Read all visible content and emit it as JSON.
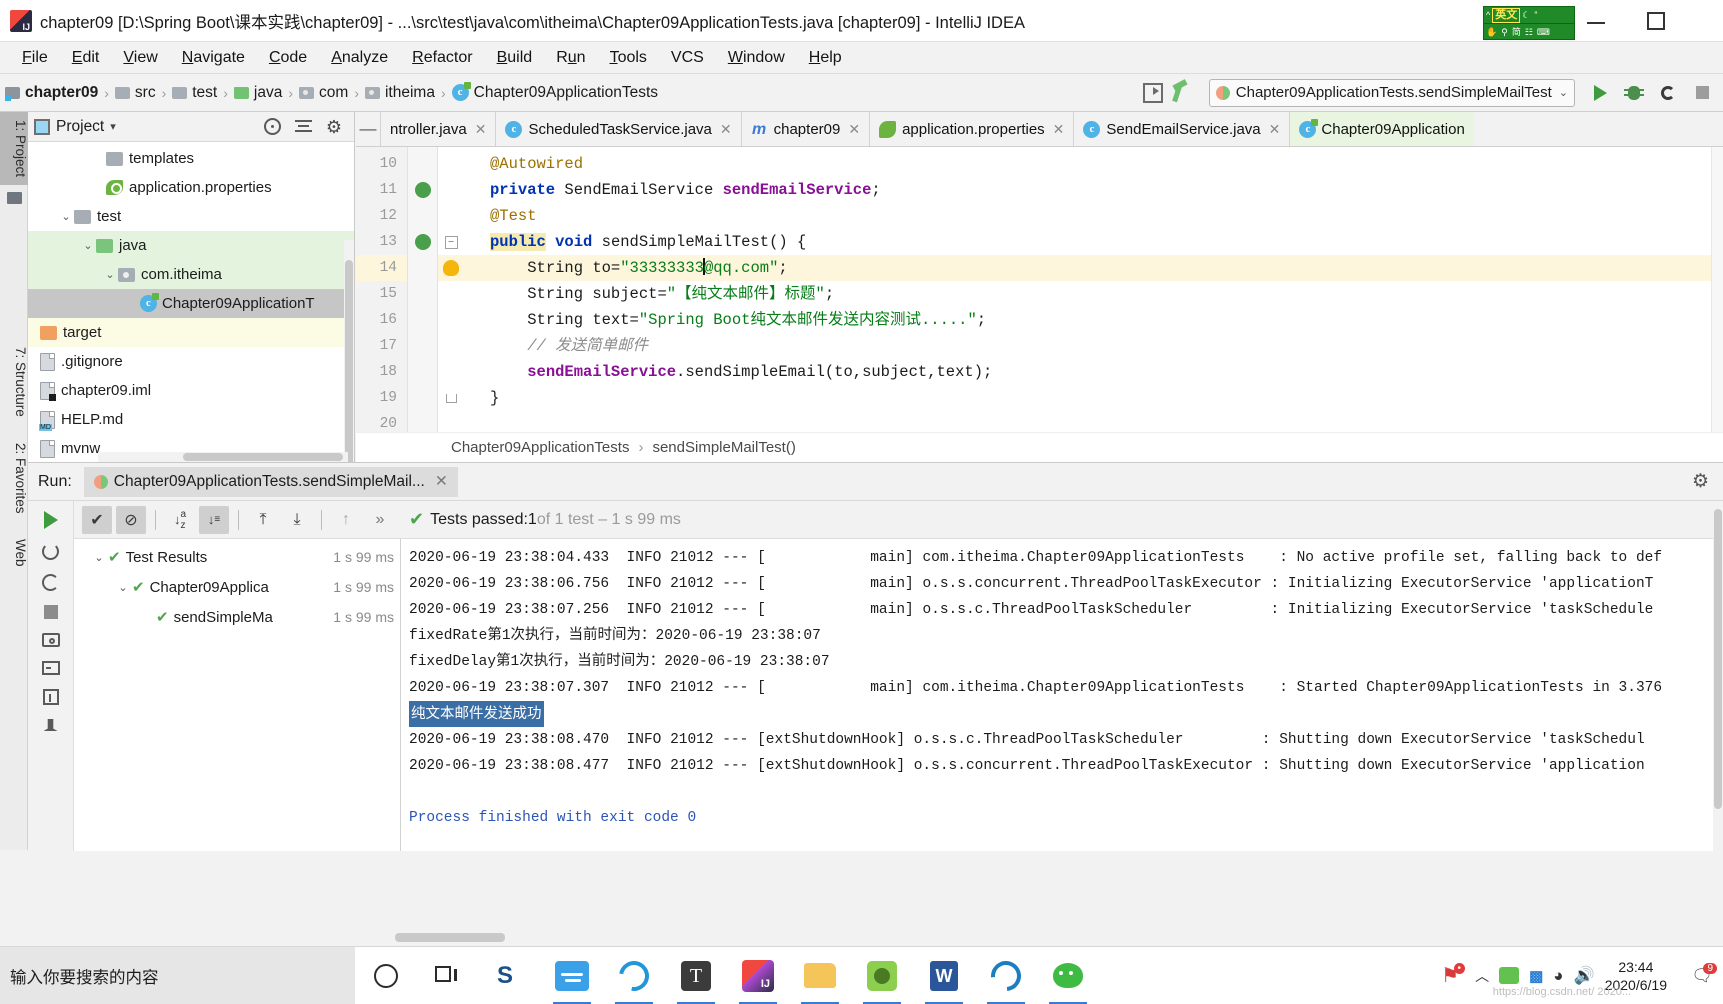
{
  "window": {
    "title": "chapter09 [D:\\Spring Boot\\课本实践\\chapter09] - ...\\src\\test\\java\\com\\itheima\\Chapter09ApplicationTests.java [chapter09] - IntelliJ IDEA",
    "logo_icon": "intellij-idea-logo",
    "minimize_label": "—",
    "maximize_label": "☐"
  },
  "ime": {
    "mode_label": "英文",
    "hand_icon": "hand-icon",
    "search_icon": "search-icon",
    "simplified_label": "简",
    "panel_icon": "soft-keyboard-icon",
    "moon_icon": "moon-icon",
    "quote_icon": "quote-icon",
    "up_icon": "caret-up-icon",
    "color": "#1f8a27"
  },
  "menubar": {
    "items": [
      {
        "label": "File",
        "mnemonic": "F"
      },
      {
        "label": "Edit",
        "mnemonic": "E"
      },
      {
        "label": "View",
        "mnemonic": "V"
      },
      {
        "label": "Navigate",
        "mnemonic": "N"
      },
      {
        "label": "Code",
        "mnemonic": "C"
      },
      {
        "label": "Analyze",
        "mnemonic": "A"
      },
      {
        "label": "Refactor",
        "mnemonic": "R"
      },
      {
        "label": "Build",
        "mnemonic": "B"
      },
      {
        "label": "Run",
        "mnemonic": "u"
      },
      {
        "label": "Tools",
        "mnemonic": "T"
      },
      {
        "label": "VCS",
        "mnemonic": "V"
      },
      {
        "label": "Window",
        "mnemonic": "W"
      },
      {
        "label": "Help",
        "mnemonic": "H"
      }
    ]
  },
  "navbar": {
    "breadcrumbs": [
      {
        "label": "chapter09",
        "icon": "project-folder-icon"
      },
      {
        "label": "src",
        "icon": "folder-icon"
      },
      {
        "label": "test",
        "icon": "folder-icon"
      },
      {
        "label": "java",
        "icon": "source-root-folder-icon"
      },
      {
        "label": "com",
        "icon": "package-icon"
      },
      {
        "label": "itheima",
        "icon": "package-icon"
      },
      {
        "label": "Chapter09ApplicationTests",
        "icon": "test-class-icon"
      }
    ],
    "separator": "›",
    "preview_icon": "preview-icon",
    "build_icon": "hammer-icon",
    "run_config": "Chapter09ApplicationTests.sendSimpleMailTest",
    "run_config_chevron": "⌄",
    "run_icon": "run-icon",
    "debug_icon": "debug-icon",
    "coverage_icon": "run-with-coverage-icon",
    "stop_icon": "stop-icon"
  },
  "stripe": {
    "project_label": "1: Project",
    "structure_label": "7: Structure",
    "favorites_label": "2: Favorites",
    "web_label": "Web"
  },
  "project_panel": {
    "title": "Project",
    "chevron": "▾",
    "locate_icon": "locate-icon",
    "collapse_icon": "collapse-all-icon",
    "settings_icon": "gear-icon",
    "tree": [
      {
        "label": "templates",
        "icon": "folder-icon",
        "indent": 4,
        "arrow": "",
        "state": "none"
      },
      {
        "label": "application.properties",
        "icon": "spring-properties-icon",
        "indent": 4,
        "arrow": "",
        "state": "none"
      },
      {
        "label": "test",
        "icon": "folder-icon",
        "indent": 2,
        "arrow": "⌄",
        "state": "none"
      },
      {
        "label": "java",
        "icon": "source-root-folder-icon",
        "indent": 3,
        "arrow": "⌄",
        "state": "green"
      },
      {
        "label": "com.itheima",
        "icon": "package-icon",
        "indent": 4,
        "arrow": "⌄",
        "state": "green"
      },
      {
        "label": "Chapter09ApplicationT",
        "icon": "test-class-icon",
        "indent": 5,
        "arrow": "",
        "state": "gray"
      },
      {
        "label": "target",
        "icon": "excluded-folder-icon",
        "indent": 1,
        "arrow": "",
        "state": "yellow"
      },
      {
        "label": ".gitignore",
        "icon": "file-icon",
        "indent": 1,
        "arrow": "",
        "state": "none"
      },
      {
        "label": "chapter09.iml",
        "icon": "iml-file-icon",
        "indent": 1,
        "arrow": "",
        "state": "none"
      },
      {
        "label": "HELP.md",
        "icon": "markdown-file-icon",
        "indent": 1,
        "arrow": "",
        "state": "none"
      },
      {
        "label": "mvnw",
        "icon": "file-icon",
        "indent": 1,
        "arrow": "",
        "state": "none"
      }
    ]
  },
  "editor": {
    "tabs": [
      {
        "label": "ntroller.java",
        "icon": "java-class-icon",
        "active": false,
        "truncated": true
      },
      {
        "label": "ScheduledTaskService.java",
        "icon": "java-class-icon",
        "active": false
      },
      {
        "label": "chapter09",
        "icon": "maven-icon",
        "active": false
      },
      {
        "label": "application.properties",
        "icon": "spring-properties-icon",
        "active": false
      },
      {
        "label": "SendEmailService.java",
        "icon": "java-class-icon",
        "active": false
      },
      {
        "label": "Chapter09Application",
        "icon": "test-class-icon",
        "active": true
      }
    ],
    "close_label": "✕",
    "minimize_tab_label": "—",
    "lines": [
      {
        "no": "10",
        "text": "@Autowired"
      },
      {
        "no": "11",
        "text": "private SendEmailService sendEmailService;"
      },
      {
        "no": "12",
        "text": "@Test"
      },
      {
        "no": "13",
        "text": "public void sendSimpleMailTest() {"
      },
      {
        "no": "14",
        "text": "String to=\"33333333@qq.com\";"
      },
      {
        "no": "15",
        "text": "String subject=\"【纯文本邮件】标题\";"
      },
      {
        "no": "16",
        "text": "String text=\"Spring Boot纯文本邮件发送内容测试.....\";"
      },
      {
        "no": "17",
        "text": "// 发送简单邮件"
      },
      {
        "no": "18",
        "text": "sendEmailService.sendSimpleEmail(to,subject,text);"
      },
      {
        "no": "19",
        "text": "}"
      },
      {
        "no": "20",
        "text": ""
      }
    ],
    "code": {
      "l10_ann": "@Autowired",
      "l11_kw": "private",
      "l11_type": " SendEmailService ",
      "l11_field": "sendEmailService",
      "l11_end": ";",
      "l12_ann": "@Test",
      "l13_kw1": "public",
      "l13_kw2": "void",
      "l13_rest": " sendSimpleMailTest() {",
      "l14_pre": "String to=",
      "l14_str1": "\"33333333",
      "l14_str2": "@qq.com\"",
      "l14_end": ";",
      "l15_pre": "String subject=",
      "l15_str": "\"【纯文本邮件】标题\"",
      "l15_end": ";",
      "l16_pre": "String text=",
      "l16_str": "\"Spring Boot纯文本邮件发送内容测试.....\"",
      "l16_end": ";",
      "l17_cmt": "// 发送简单邮件",
      "l18_field": "sendEmailService",
      "l18_rest": ".sendSimpleEmail(to,subject,text);",
      "l19_brace": "}"
    },
    "breadcrumb_class": "Chapter09ApplicationTests",
    "breadcrumb_method": "sendSimpleMailTest()",
    "breadcrumb_sep": "›",
    "bulb_icon": "intention-bulb-icon",
    "gutter_run_icon": "run-gutter-icon",
    "gutter_bean_icon": "spring-bean-gutter-icon",
    "fold_icon": "−"
  },
  "run_panel": {
    "run_label": "Run:",
    "tab_label": "Chapter09ApplicationTests.sendSimpleMail...",
    "tab_close": "✕",
    "settings_icon": "gear-icon",
    "gutter_icons": [
      "rerun-icon",
      "rerun-failed-icon",
      "stop-icon",
      "screenshot-icon",
      "toggle-icon",
      "export-icon",
      "pin-icon"
    ],
    "toolbar": [
      {
        "icon": "show-passed-icon",
        "glyph": "✔",
        "active": true
      },
      {
        "icon": "show-ignored-icon",
        "glyph": "⊘",
        "active": true
      },
      {
        "icon": "sort-alphabetically-icon",
        "glyph": "↓a",
        "active": false
      },
      {
        "icon": "sort-by-duration-icon",
        "glyph": "↓≡",
        "active": true
      },
      {
        "icon": "expand-all-icon",
        "glyph": "⤒",
        "active": false
      },
      {
        "icon": "collapse-all-icon",
        "glyph": "⤓",
        "active": false
      },
      {
        "icon": "previous-failed-icon",
        "glyph": "↑",
        "active": false
      },
      {
        "icon": "more-icon",
        "glyph": "»",
        "active": false
      }
    ],
    "status_check": "✔",
    "status_text": "Tests passed: ",
    "status_count": "1",
    "status_suffix": " of 1 test – 1 s 99 ms",
    "tree": [
      {
        "label": "Test Results",
        "duration": "1 s 99 ms",
        "arrow": "⌄",
        "indent": 0,
        "selected": false
      },
      {
        "label": "Chapter09Applica",
        "duration": "1 s 99 ms",
        "arrow": "⌄",
        "indent": 1,
        "selected": false
      },
      {
        "label": "sendSimpleMa",
        "duration": "1 s 99 ms",
        "arrow": "",
        "indent": 2,
        "selected": false
      }
    ],
    "console": [
      {
        "type": "log",
        "ts": "2020-06-19 23:38:04.433",
        "level": "INFO",
        "pid": "21012",
        "thread": "main",
        "logger": "com.itheima.Chapter09ApplicationTests",
        "msg": "No active profile set, falling back to def"
      },
      {
        "type": "log",
        "ts": "2020-06-19 23:38:06.756",
        "level": "INFO",
        "pid": "21012",
        "thread": "main",
        "logger": "o.s.s.concurrent.ThreadPoolTaskExecutor",
        "msg": "Initializing ExecutorService 'applicationT"
      },
      {
        "type": "log",
        "ts": "2020-06-19 23:38:07.256",
        "level": "INFO",
        "pid": "21012",
        "thread": "main",
        "logger": "o.s.s.c.ThreadPoolTaskScheduler",
        "msg": "Initializing ExecutorService 'taskSchedule"
      },
      {
        "type": "plain",
        "text": "fixedRate第1次执行，当前时间为：2020-06-19 23:38:07"
      },
      {
        "type": "plain",
        "text": "fixedDelay第1次执行，当前时间为：2020-06-19 23:38:07"
      },
      {
        "type": "log",
        "ts": "2020-06-19 23:38:07.307",
        "level": "INFO",
        "pid": "21012",
        "thread": "main",
        "logger": "com.itheima.Chapter09ApplicationTests",
        "msg": "Started Chapter09ApplicationTests in 3.376"
      },
      {
        "type": "highlight",
        "text": "纯文本邮件发送成功"
      },
      {
        "type": "log",
        "ts": "2020-06-19 23:38:08.470",
        "level": "INFO",
        "pid": "21012",
        "thread": "extShutdownHook",
        "logger": "o.s.s.c.ThreadPoolTaskScheduler",
        "msg": "Shutting down ExecutorService 'taskSchedul"
      },
      {
        "type": "log",
        "ts": "2020-06-19 23:38:08.477",
        "level": "INFO",
        "pid": "21012",
        "thread": "extShutdownHook",
        "logger": "o.s.s.concurrent.ThreadPoolTaskExecutor",
        "msg": "Shutting down ExecutorService 'application"
      },
      {
        "type": "blank",
        "text": ""
      },
      {
        "type": "exit",
        "text": "Process finished with exit code 0"
      }
    ],
    "log_dashes": "---"
  },
  "taskbar": {
    "search_text": "输入你要搜索的内容",
    "items": [
      {
        "icon": "cortana-circle-icon",
        "active": false
      },
      {
        "icon": "task-view-icon",
        "active": false
      },
      {
        "icon": "sogou-icon",
        "active": false
      },
      {
        "icon": "xunlei-icon",
        "active": true
      },
      {
        "icon": "internet-explorer-icon",
        "active": true
      },
      {
        "icon": "typora-icon",
        "active": true
      },
      {
        "icon": "intellij-idea-icon",
        "active": true
      },
      {
        "icon": "file-explorer-icon",
        "active": true
      },
      {
        "icon": "navicat-icon",
        "active": true
      },
      {
        "icon": "word-icon",
        "active": true
      },
      {
        "icon": "edge-icon",
        "active": true
      },
      {
        "icon": "wechat-icon",
        "active": true
      }
    ],
    "tray": {
      "notify_badge_icon": "notification-icon",
      "chevron_up": "︿",
      "app_icon": "tray-app-icon",
      "network_icon": "wifi-icon",
      "volume_icon": "speaker-icon",
      "time": "23:44",
      "date": "2020/6/19",
      "action_center_count": "9"
    },
    "watermark": "https://blog.csdn.net/  2020..."
  }
}
